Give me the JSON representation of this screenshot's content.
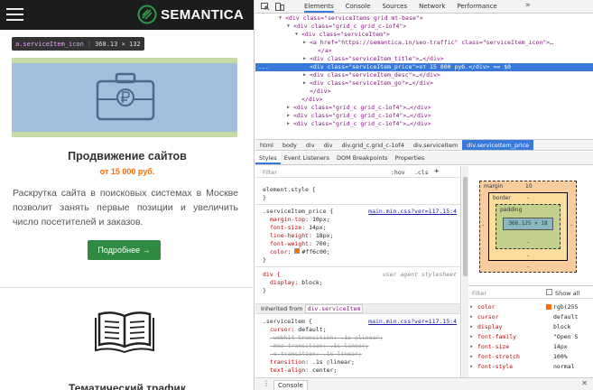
{
  "site": {
    "logo_text": "SEMANTICA",
    "tooltip_tag": "a.serviceItem_icon",
    "tooltip_size": "368.13 × 132",
    "service_title": "Продвижение сайтов",
    "service_price": "от 15 000 руб.",
    "service_desc": "Раскрутка сайта в поисковых системах в Москве позволит занять первые позиции и увеличить число посетителей и заказов.",
    "more_button": "Подробнее →",
    "service2_title": "Тематический трафик"
  },
  "devtools": {
    "tabs": [
      "Elements",
      "Console",
      "Sources",
      "Network",
      "Performance"
    ],
    "more_tabs": "»",
    "close": "✕",
    "elements_lines": [
      {
        "indent": 0,
        "html": "<div class=\"serviceItems grid mt-base\">",
        "tri": "▼",
        "sel": false
      },
      {
        "indent": 1,
        "html": "<div class=\"grid_c grid_c-1of4\">",
        "tri": "▼",
        "sel": false
      },
      {
        "indent": 2,
        "html": "<div class=\"serviceItem\">",
        "tri": "▼",
        "sel": false
      },
      {
        "indent": 3,
        "html": "<a href=\"https://semantica.in/seo-traffic\" class=\"serviceItem_icon\">…",
        "tri": "▶",
        "sel": false
      },
      {
        "indent": 4,
        "html": "</a>",
        "tri": "",
        "sel": false
      },
      {
        "indent": 3,
        "html": "<div class=\"serviceItem_title\">…</div>",
        "tri": "▶",
        "sel": false
      },
      {
        "indent": 3,
        "html": "<div class=\"serviceItem_price\">от 15 000 руб.</div> == $0",
        "tri": "",
        "sel": true
      },
      {
        "indent": 3,
        "html": "<div class=\"serviceItem_desc\">…</div>",
        "tri": "▶",
        "sel": false
      },
      {
        "indent": 3,
        "html": "<div class=\"serviceItem_go\">…</div>",
        "tri": "▶",
        "sel": false
      },
      {
        "indent": 3,
        "html": "</div>",
        "tri": "",
        "sel": false
      },
      {
        "indent": 2,
        "html": "</div>",
        "tri": "",
        "sel": false
      },
      {
        "indent": 1,
        "html": "<div class=\"grid_c grid_c-1of4\">…</div>",
        "tri": "▶",
        "sel": false
      },
      {
        "indent": 1,
        "html": "<div class=\"grid_c grid_c-1of4\">…</div>",
        "tri": "▶",
        "sel": false
      },
      {
        "indent": 1,
        "html": "<div class=\"grid_c grid_c-1of4\">…</div>",
        "tri": "▶",
        "sel": false
      }
    ],
    "selected_marker": "...",
    "breadcrumbs": [
      "html",
      "body",
      "div",
      "div",
      "div.grid_c.grid_c-1of4",
      "div.serviceItem",
      "div.serviceItem_price"
    ],
    "style_tabs": [
      "Styles",
      "Event Listeners",
      "DOM Breakpoints",
      "Properties"
    ],
    "filter_placeholder": "Filter",
    "filter_hov": ":hov",
    "filter_cls": ".cls",
    "filter_plus": "+",
    "element_style": "element.style {",
    "close_brace": "}",
    "rule1_selector": ".serviceItem_price {",
    "rule1_source": "main.min.css?ver=117.15:4",
    "rule1_props": [
      {
        "name": "margin-top",
        "value": "10px;"
      },
      {
        "name": "font-size",
        "value": "14px;"
      },
      {
        "name": "line-height",
        "value": "18px;"
      },
      {
        "name": "font-weight",
        "value": "700;"
      },
      {
        "name": "color",
        "value": "#ff6c00;"
      }
    ],
    "rule1_color": "#ff6c00",
    "rule2_selector": "div {",
    "rule2_source": "user agent stylesheet",
    "rule2_prop": "display",
    "rule2_value": "block;",
    "inherited_label": "Inherited from",
    "inherited_from": "div.serviceItem",
    "rule3_selector": ".serviceItem {",
    "rule3_source": "main.min.css?ver=117.15:4",
    "rule3_props": [
      {
        "name": "cursor",
        "value": "default;",
        "strike": false
      },
      {
        "name": "-webkit-transition",
        "value": ": .1s ▯linear;",
        "strike": true
      },
      {
        "name": "-moz-transition",
        "value": ": .1s linear;",
        "strike": true
      },
      {
        "name": "-o-transition",
        "value": ": .1s linear;",
        "strike": true
      },
      {
        "name": "transition",
        "value": ": .1s ▯linear;",
        "strike": false
      },
      {
        "name": "text-align",
        "value": "center;",
        "strike": false
      }
    ],
    "box_model": {
      "margin_label": "margin",
      "margin_top": "10",
      "margin_bottom": "-",
      "margin_left": "-",
      "margin_right": "-",
      "border_label": "border",
      "border_value": "-",
      "padding_label": "padding",
      "padding_value": "-",
      "content": "368.125 × 18"
    },
    "computed_filter": "Filter",
    "show_all": "Show all",
    "computed": [
      {
        "name": "color",
        "value": "rgb(255"
      },
      {
        "name": "cursor",
        "value": "default"
      },
      {
        "name": "display",
        "value": "block"
      },
      {
        "name": "font-family",
        "value": "\"Open S"
      },
      {
        "name": "font-size",
        "value": "14px"
      },
      {
        "name": "font-stretch",
        "value": "100%"
      },
      {
        "name": "font-style",
        "value": "normal"
      }
    ],
    "console_label": "Console"
  }
}
